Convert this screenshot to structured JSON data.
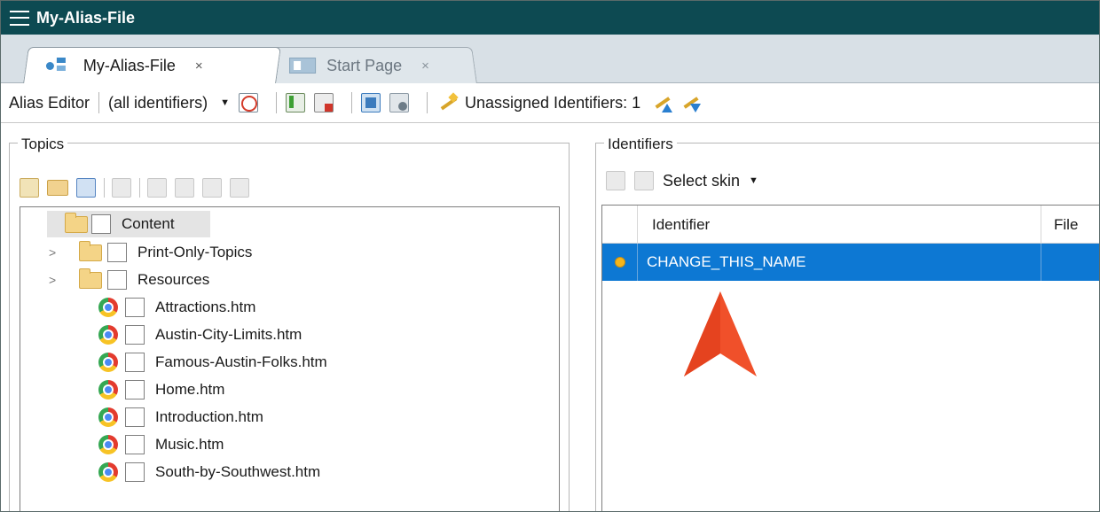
{
  "window": {
    "title": "My-Alias-File"
  },
  "tabs": [
    {
      "label": "My-Alias-File",
      "close": "×",
      "icon": "alias-file-icon",
      "active": true
    },
    {
      "label": "Start Page",
      "close": "×",
      "icon": "start-page-icon",
      "active": false
    }
  ],
  "toolbar": {
    "editor_label": "Alias Editor",
    "filter_value": "(all identifiers)",
    "unassigned_label": "Unassigned Identifiers: 1"
  },
  "topics": {
    "title": "Topics",
    "root": "Content",
    "items": [
      {
        "label": "Print-Only-Topics",
        "type": "folder",
        "expandable": true
      },
      {
        "label": "Resources",
        "type": "folder",
        "expandable": true
      },
      {
        "label": "Attractions.htm",
        "type": "file"
      },
      {
        "label": "Austin-City-Limits.htm",
        "type": "file"
      },
      {
        "label": "Famous-Austin-Folks.htm",
        "type": "file"
      },
      {
        "label": "Home.htm",
        "type": "file"
      },
      {
        "label": "Introduction.htm",
        "type": "file"
      },
      {
        "label": "Music.htm",
        "type": "file"
      },
      {
        "label": "South-by-Southwest.htm",
        "type": "file"
      }
    ]
  },
  "identifiers": {
    "title": "Identifiers",
    "skin_label": "Select skin",
    "columns": [
      "Identifier",
      "File"
    ],
    "rows": [
      {
        "identifier": "CHANGE_THIS_NAME",
        "file": ""
      }
    ]
  },
  "colors": {
    "titlebar": "#0d4a52",
    "selection": "#0d78d3",
    "arrow": "#f0502a"
  }
}
